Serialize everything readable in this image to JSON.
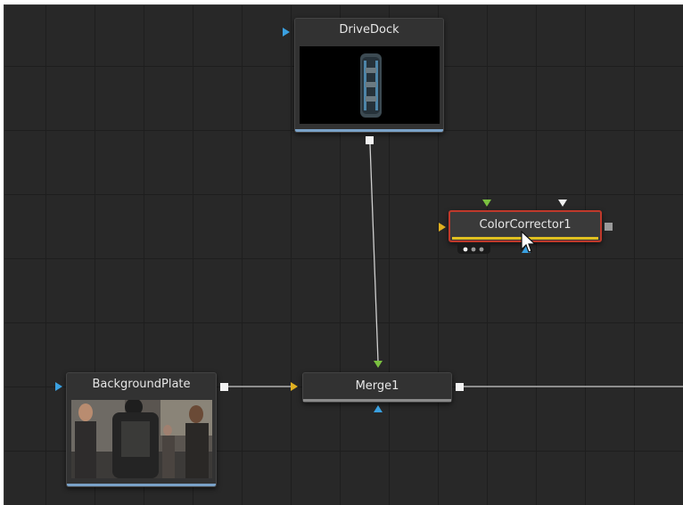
{
  "nodes": {
    "drive_dock": {
      "label": "DriveDock"
    },
    "color_corrector": {
      "label": "ColorCorrector1",
      "selected": true
    },
    "background_plate": {
      "label": "BackgroundPlate"
    },
    "merge": {
      "label": "Merge1"
    }
  },
  "colors": {
    "canvas": "#282828",
    "grid": "#1e1e1e",
    "node": "#323232",
    "selection_outline": "#c0392b",
    "yellow_input": "#e0b020",
    "green_input": "#7ac040",
    "blue_input": "#3aa0e0",
    "node_underline": "#7aa2c8"
  },
  "icons": {
    "mouse_cursor": "arrow-cursor-icon",
    "node_options": "three-dots-icon"
  }
}
